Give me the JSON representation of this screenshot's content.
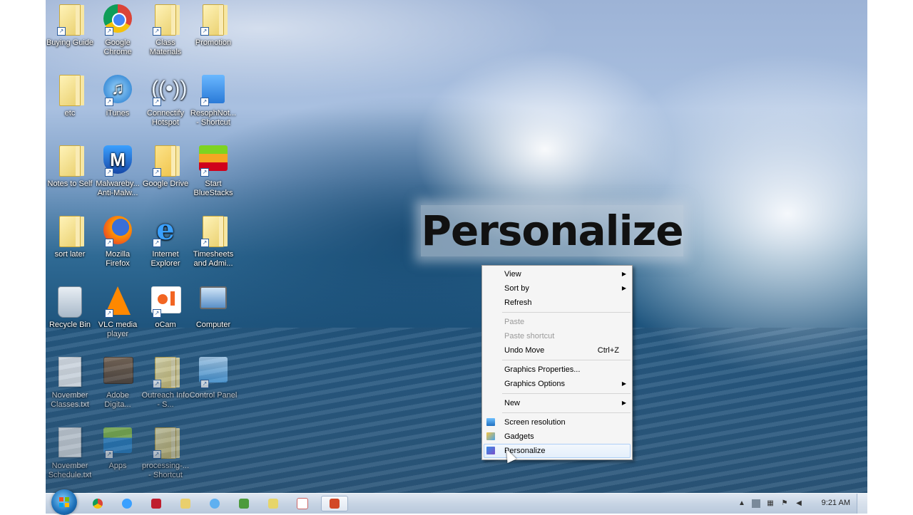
{
  "overlay": {
    "title": "Personalize"
  },
  "desktop_icons": [
    {
      "label": "Buying Guide",
      "icon": "folder-icon"
    },
    {
      "label": "Google Chrome",
      "icon": "chrome-icon"
    },
    {
      "label": "Class Materials",
      "icon": "folder-icon"
    },
    {
      "label": "Promotion",
      "icon": "folder-icon"
    },
    {
      "label": "etc",
      "icon": "folder-icon"
    },
    {
      "label": "iTunes",
      "icon": "itunes-icon"
    },
    {
      "label": "Connectify Hotspot",
      "icon": "wifi-icon"
    },
    {
      "label": "ResophNot... - Shortcut",
      "icon": "notepad-icon"
    },
    {
      "label": "Notes to Self",
      "icon": "folder-icon"
    },
    {
      "label": "Malwareby... Anti-Malw...",
      "icon": "malwarebytes-icon"
    },
    {
      "label": "Google Drive",
      "icon": "google-drive-icon"
    },
    {
      "label": "Start BlueStacks",
      "icon": "bluestacks-icon"
    },
    {
      "label": "sort later",
      "icon": "folder-icon"
    },
    {
      "label": "Mozilla Firefox",
      "icon": "firefox-icon"
    },
    {
      "label": "Internet Explorer",
      "icon": "internet-explorer-icon"
    },
    {
      "label": "Timesheets and Admi...",
      "icon": "folder-icon"
    },
    {
      "label": "Recycle Bin",
      "icon": "recycle-bin-icon"
    },
    {
      "label": "VLC media player",
      "icon": "vlc-icon"
    },
    {
      "label": "oCam",
      "icon": "ocam-icon"
    },
    {
      "label": "Computer",
      "icon": "computer-icon"
    },
    {
      "label": "November Classes.txt",
      "icon": "text-file-icon"
    },
    {
      "label": "Adobe Digita...",
      "icon": "adobe-digital-editions-icon"
    },
    {
      "label": "Outreach Info - S...",
      "icon": "folder-icon"
    },
    {
      "label": "Control Panel",
      "icon": "control-panel-icon"
    },
    {
      "label": "November Schedule.txt",
      "icon": "text-file-icon"
    },
    {
      "label": "Apps",
      "icon": "apps-icon"
    },
    {
      "label": "processing-... - Shortcut",
      "icon": "folder-icon"
    }
  ],
  "context_menu": {
    "view": "View",
    "sort_by": "Sort by",
    "refresh": "Refresh",
    "paste": "Paste",
    "paste_shortcut": "Paste shortcut",
    "undo_move": "Undo Move",
    "undo_move_shortcut": "Ctrl+Z",
    "graphics_properties": "Graphics Properties...",
    "graphics_options": "Graphics Options",
    "new": "New",
    "screen_resolution": "Screen resolution",
    "gadgets": "Gadgets",
    "personalize": "Personalize"
  },
  "taskbar": {
    "clock": "9:21 AM",
    "pinned": [
      "chrome-icon",
      "internet-explorer-icon",
      "filezilla-icon",
      "folder-icon",
      "network-icon",
      "app-icon",
      "notepad-icon",
      "document-icon",
      "powerpoint-icon"
    ]
  },
  "colors": {
    "menu_bg": "#f5f5f5",
    "menu_hover": "#e4effb",
    "taskbar": "#c7d4e4"
  }
}
